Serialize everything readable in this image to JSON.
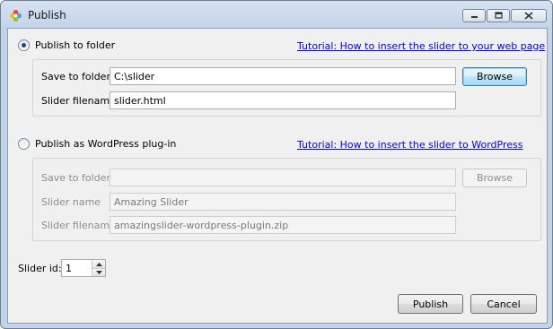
{
  "window": {
    "title": "Publish",
    "controls": [
      "minimize-icon",
      "maximize-icon",
      "close-icon"
    ],
    "app_icon": "flower-icon"
  },
  "folder_option": {
    "label": "Publish to folder",
    "checked": true,
    "tutorial_link": "Tutorial: How to insert the slider to your web page",
    "save_label": "Save to folder",
    "save_value": "C:\\slider",
    "browse_label": "Browse",
    "filename_label": "Slider filename",
    "filename_value": "slider.html"
  },
  "wordpress_option": {
    "label": "Publish as WordPress plug-in",
    "checked": false,
    "tutorial_link": "Tutorial: How to insert the slider to WordPress",
    "save_label": "Save to folder",
    "save_value": "",
    "browse_label": "Browse",
    "name_label": "Slider name",
    "name_value": "Amazing Slider",
    "filename_label": "Slider filename",
    "filename_value": "amazingslider-wordpress-plugin.zip"
  },
  "slider_id": {
    "label": "Slider id:",
    "value": "1"
  },
  "footer": {
    "publish_label": "Publish",
    "cancel_label": "Cancel"
  },
  "colors": {
    "link": "#0000ee",
    "title_gradient_top": "#d6e2f1",
    "client_bg": "#f0f0f0"
  }
}
